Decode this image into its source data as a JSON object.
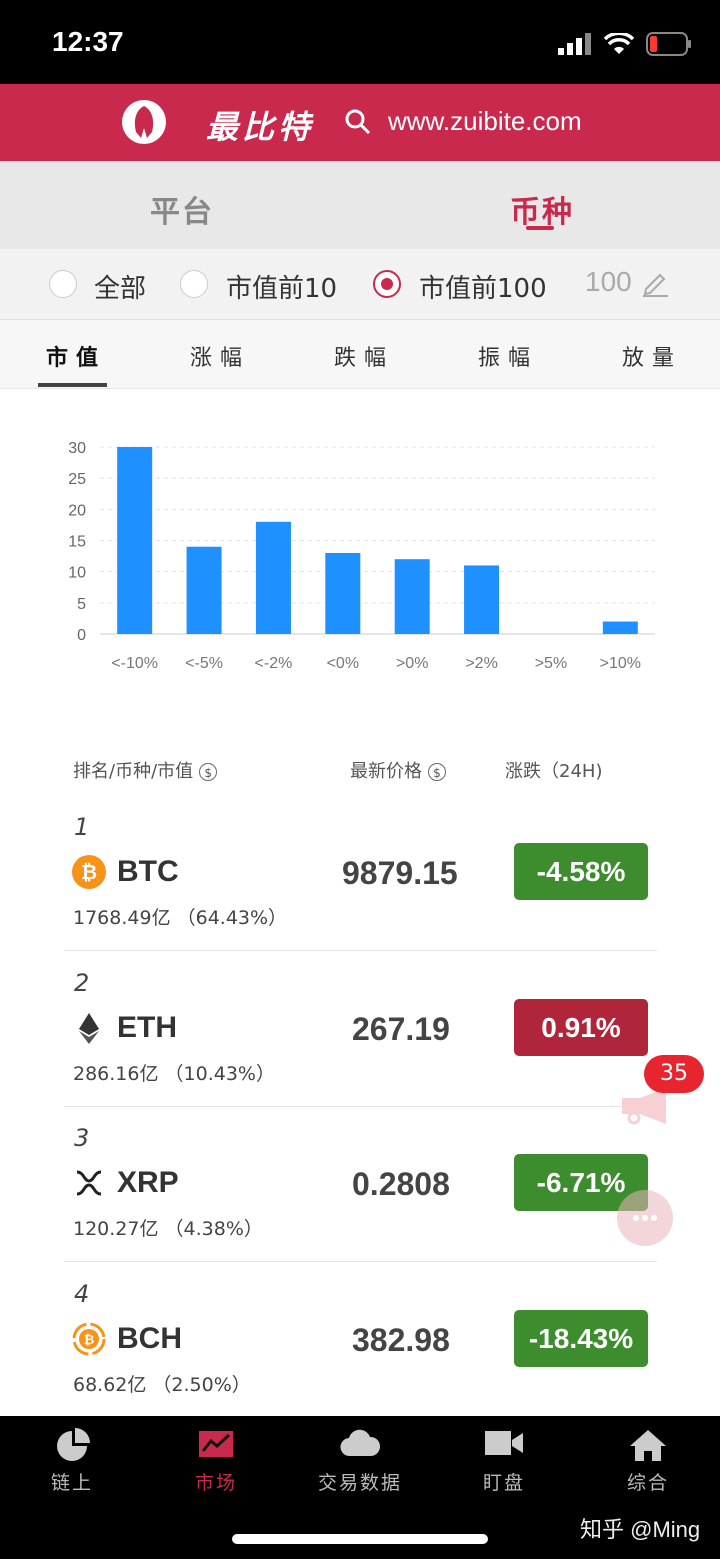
{
  "status": {
    "time": "12:37"
  },
  "header": {
    "brand": "最比特",
    "url": "www.zuibite.com"
  },
  "top_tabs": [
    {
      "label": "平台"
    },
    {
      "label": "币种"
    }
  ],
  "filters": {
    "options": [
      {
        "label": "全部"
      },
      {
        "label": "市值前10"
      },
      {
        "label": "市值前100"
      }
    ],
    "selected": "市值前100",
    "count": "100"
  },
  "sub_tabs": [
    {
      "label": "市值"
    },
    {
      "label": "涨幅"
    },
    {
      "label": "跌幅"
    },
    {
      "label": "振幅"
    },
    {
      "label": "放量"
    }
  ],
  "chart_data": {
    "type": "bar",
    "categories": [
      "<-10%",
      "<-5%",
      "<-2%",
      "<0%",
      ">0%",
      ">2%",
      ">5%",
      ">10%"
    ],
    "values": [
      30,
      14,
      18,
      13,
      12,
      11,
      0,
      2
    ],
    "yticks": [
      0,
      5,
      10,
      15,
      20,
      25,
      30
    ],
    "ylim": [
      0,
      30
    ],
    "grid": true,
    "color": "#1e90ff"
  },
  "table": {
    "headers": {
      "rank": "排名/币种/市值",
      "price": "最新价格",
      "change": "涨跌（24H)"
    },
    "rows": [
      {
        "rank": "1",
        "symbol": "BTC",
        "cap": "1768.49亿 （64.43%）",
        "price": "9879.15",
        "change": "-4.58%",
        "dir": "down"
      },
      {
        "rank": "2",
        "symbol": "ETH",
        "cap": "286.16亿 （10.43%）",
        "price": "267.19",
        "change": "0.91%",
        "dir": "up"
      },
      {
        "rank": "3",
        "symbol": "XRP",
        "cap": "120.27亿 （4.38%）",
        "price": "0.2808",
        "change": "-6.71%",
        "dir": "down"
      },
      {
        "rank": "4",
        "symbol": "BCH",
        "cap": "68.62亿 （2.50%）",
        "price": "382.98",
        "change": "-18.43%",
        "dir": "down"
      }
    ]
  },
  "badge": {
    "count": "35"
  },
  "bottom_nav": [
    {
      "label": "链上"
    },
    {
      "label": "市场"
    },
    {
      "label": "交易数据"
    },
    {
      "label": "盯盘"
    },
    {
      "label": "综合"
    }
  ],
  "watermark": "知乎 @Ming",
  "colors": {
    "brand": "#c8294c",
    "up": "#b0253a",
    "down": "#3d8c2e",
    "bar": "#1e90ff"
  }
}
